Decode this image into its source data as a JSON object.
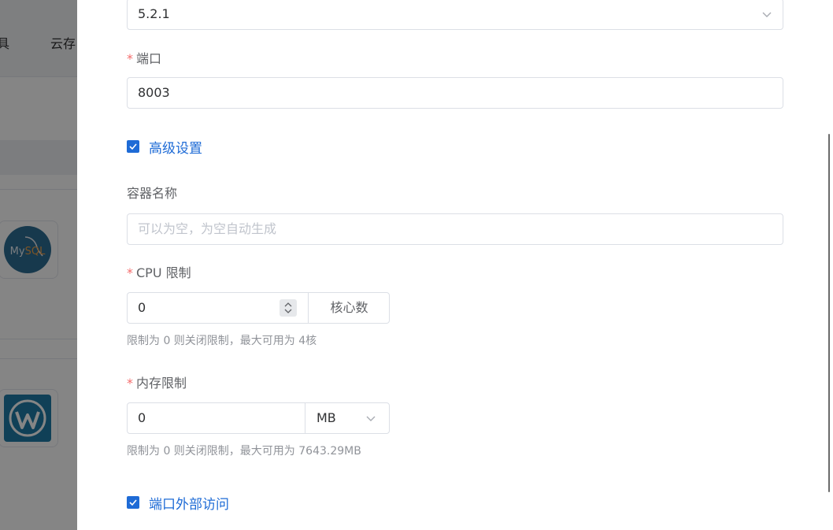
{
  "background": {
    "nav_items": [
      "具",
      "云存"
    ]
  },
  "form": {
    "version": {
      "value": "5.2.1"
    },
    "port": {
      "label": "端口",
      "value": "8003"
    },
    "advanced": {
      "label": "高级设置",
      "checked": true
    },
    "container_name": {
      "label": "容器名称",
      "placeholder": "可以为空，为空自动生成"
    },
    "cpu_limit": {
      "label": "CPU 限制",
      "value": "0",
      "append": "核心数",
      "hint": "限制为 0 则关闭限制，最大可用为 4核"
    },
    "memory_limit": {
      "label": "内存限制",
      "value": "0",
      "unit": "MB",
      "hint": "限制为 0 则关闭限制，最大可用为 7643.29MB"
    },
    "port_external": {
      "label": "端口外部访问",
      "checked": true
    }
  },
  "colors": {
    "primary": "#1e6bd6",
    "required": "#f56c6c",
    "border": "#dcdfe6",
    "overlay": "rgba(0,0,0,0.48)"
  },
  "icons": [
    "mysql-icon",
    "wordpress-icon",
    "chevron-down-icon",
    "check-icon",
    "stepper-icon"
  ]
}
